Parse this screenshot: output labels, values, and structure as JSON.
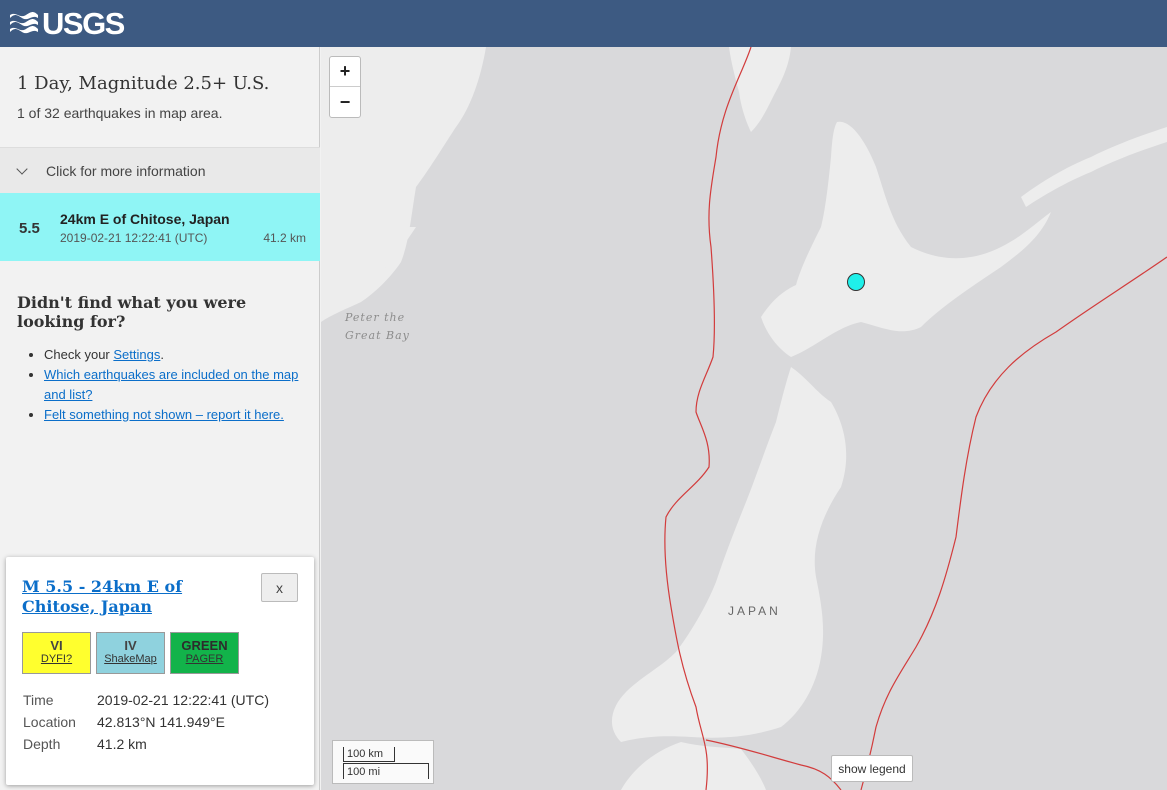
{
  "header": {
    "logo_text": "USGS"
  },
  "sidebar": {
    "title": "1 Day, Magnitude 2.5+ U.S.",
    "count_text": "1 of 32 earthquakes in map area.",
    "more_info_label": "Click for more information",
    "earthquake": {
      "magnitude": "5.5",
      "place": "24km E of Chitose, Japan",
      "time": "2019-02-21 12:22:41 (UTC)",
      "depth": "41.2 km"
    },
    "not_found_heading": "Didn't find what you were looking for?",
    "help": {
      "check_prefix": "Check your ",
      "settings_link": "Settings",
      "check_suffix": ".",
      "which_link": "Which earthquakes are included on the map and list?",
      "felt_link": "Felt something not shown – report it here."
    }
  },
  "popup": {
    "title": "M 5.5 - 24km E of Chitose, Japan",
    "close_label": "x",
    "badges": {
      "dyfi": {
        "value": "VI",
        "label": "DYFI?",
        "color": "#ffff2e"
      },
      "shakemap": {
        "value": "IV",
        "label": "ShakeMap",
        "color": "#8fd2de"
      },
      "pager": {
        "value": "GREEN",
        "label": "PAGER",
        "color": "#12b34a"
      }
    },
    "details": {
      "time_label": "Time",
      "time_value": "2019-02-21 12:22:41 (UTC)",
      "location_label": "Location",
      "location_value": "42.813°N 141.949°E",
      "depth_label": "Depth",
      "depth_value": "41.2 km"
    }
  },
  "map": {
    "zoom_in": "+",
    "zoom_out": "−",
    "label_bay_line1": "Peter the",
    "label_bay_line2": "Great Bay",
    "label_country": "JAPAN",
    "scale_km": "100 km",
    "scale_mi": "100 mi",
    "legend_button": "show legend",
    "marker_color": "#1ff0ea",
    "land_color": "#ededed",
    "sea_color": "#d9d9db",
    "plate_boundary_color": "#d23c3c"
  }
}
